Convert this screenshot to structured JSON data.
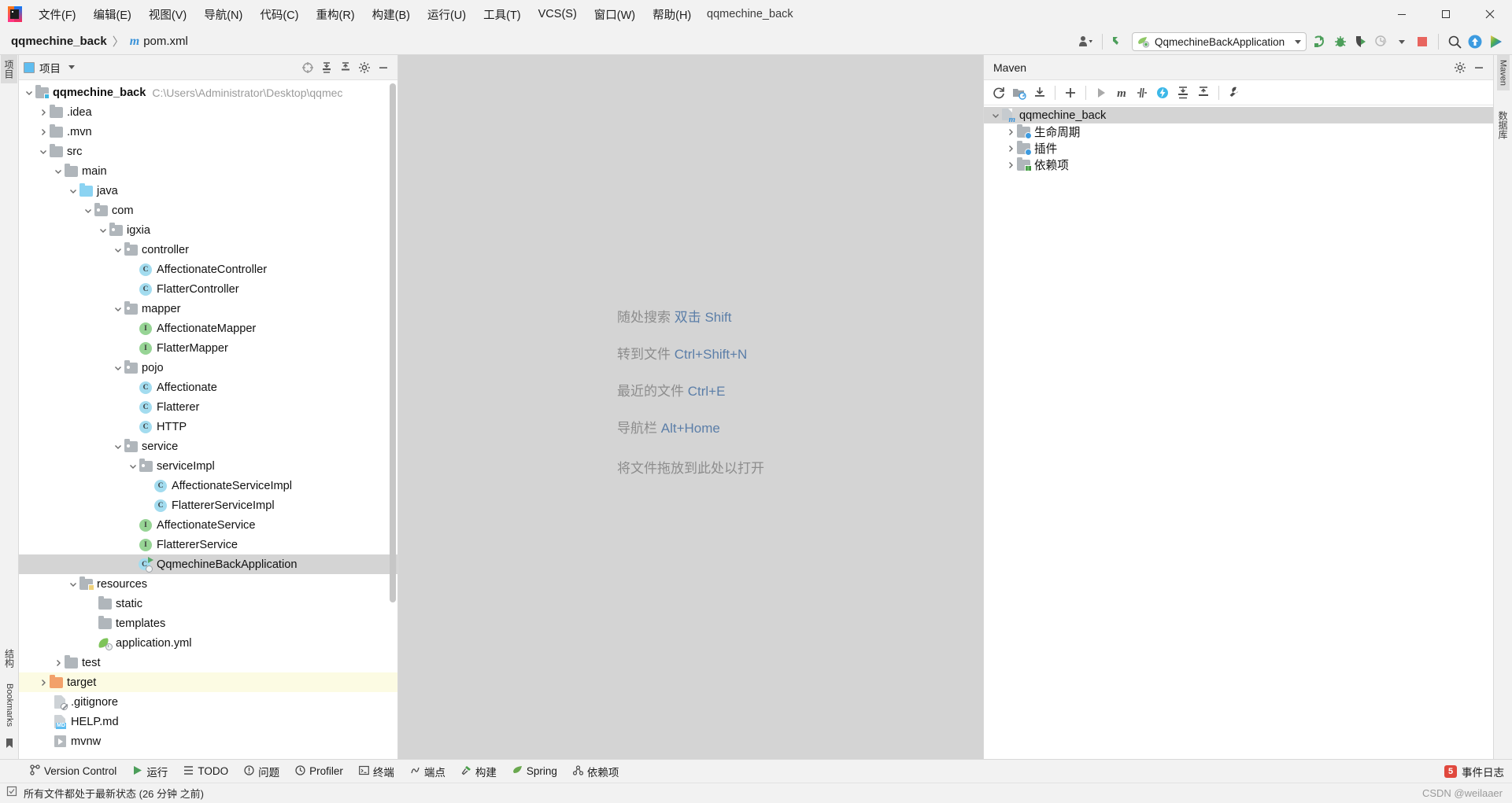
{
  "window": {
    "title": "qqmechine_back",
    "menus": [
      {
        "label": "文件(F)",
        "mnemonic": "F"
      },
      {
        "label": "编辑(E)",
        "mnemonic": "E"
      },
      {
        "label": "视图(V)",
        "mnemonic": "V"
      },
      {
        "label": "导航(N)",
        "mnemonic": "N"
      },
      {
        "label": "代码(C)",
        "mnemonic": "C"
      },
      {
        "label": "重构(R)",
        "mnemonic": "R"
      },
      {
        "label": "构建(B)",
        "mnemonic": "B"
      },
      {
        "label": "运行(U)",
        "mnemonic": "U"
      },
      {
        "label": "工具(T)",
        "mnemonic": "T"
      },
      {
        "label": "VCS(S)",
        "mnemonic": "S"
      },
      {
        "label": "窗口(W)",
        "mnemonic": "W"
      },
      {
        "label": "帮助(H)",
        "mnemonic": "H"
      }
    ],
    "controls": {
      "minimize": "minimize-icon",
      "maximize": "maximize-icon",
      "close": "close-icon"
    }
  },
  "breadcrumb": {
    "project": "qqmechine_back",
    "separator": "〉",
    "maven_glyph": "m",
    "file": "pom.xml"
  },
  "toolbar": {
    "account_icon": "user-account-icon",
    "updates_icon": "check-updates-arrow-icon",
    "run_config": {
      "icon": "spring-boot-run-config-icon",
      "label": "QqmechineBackApplication",
      "dropdown_icon": "chevron-down-icon"
    },
    "actions": [
      {
        "name": "run-button",
        "icon": "run-green-arrow-icon"
      },
      {
        "name": "debug-button",
        "icon": "debug-bug-icon"
      },
      {
        "name": "run-with-coverage-button",
        "icon": "coverage-shield-icon"
      },
      {
        "name": "profiler-button",
        "icon": "profiler-clock-icon"
      },
      {
        "name": "profiler-dropdown",
        "icon": "chevron-down-icon"
      },
      {
        "name": "stop-button",
        "icon": "stop-square-icon"
      },
      {
        "name": "search-everywhere-button",
        "icon": "search-icon"
      },
      {
        "name": "update-project-button",
        "icon": "blue-up-arrow-icon"
      },
      {
        "name": "ide-assistant-button",
        "icon": "rainbow-play-icon"
      }
    ]
  },
  "left_rail": {
    "tabs": [
      "项目"
    ],
    "bottom_tabs": [
      "结构",
      "Bookmarks"
    ]
  },
  "right_rail": {
    "tabs": [
      "Maven",
      "数据库"
    ]
  },
  "project_panel": {
    "title": "项目",
    "dropdown_icon": "chevron-down-icon",
    "header_icons": [
      {
        "name": "select-opened-file-icon",
        "icon": "crosshair-icon"
      },
      {
        "name": "expand-all-icon",
        "icon": "expand-all-icon"
      },
      {
        "name": "collapse-all-icon",
        "icon": "collapse-all-icon"
      },
      {
        "name": "settings-icon",
        "icon": "gear-icon"
      },
      {
        "name": "hide-panel-icon",
        "icon": "minus-icon"
      }
    ],
    "tree": [
      {
        "label": "qqmechine_back",
        "path": "C:\\Users\\Administrator\\Desktop\\qqmec",
        "depth": 0,
        "icon": "module-folder-icon",
        "arrow": "expanded",
        "bold": true
      },
      {
        "label": ".idea",
        "depth": 1,
        "icon": "folder-icon",
        "arrow": "collapsed"
      },
      {
        "label": ".mvn",
        "depth": 1,
        "icon": "folder-icon",
        "arrow": "collapsed"
      },
      {
        "label": "src",
        "depth": 1,
        "icon": "folder-icon",
        "arrow": "expanded"
      },
      {
        "label": "main",
        "depth": 2,
        "icon": "folder-icon",
        "arrow": "expanded"
      },
      {
        "label": "java",
        "depth": 3,
        "icon": "source-folder-icon",
        "arrow": "expanded"
      },
      {
        "label": "com",
        "depth": 4,
        "icon": "package-folder-icon",
        "arrow": "expanded"
      },
      {
        "label": "igxia",
        "depth": 5,
        "icon": "package-folder-icon",
        "arrow": "expanded"
      },
      {
        "label": "controller",
        "depth": 6,
        "icon": "package-folder-icon",
        "arrow": "expanded"
      },
      {
        "label": "AffectionateController",
        "depth": 7,
        "icon": "java-class-icon"
      },
      {
        "label": "FlatterController",
        "depth": 7,
        "icon": "java-class-icon"
      },
      {
        "label": "mapper",
        "depth": 6,
        "icon": "package-folder-icon",
        "arrow": "expanded"
      },
      {
        "label": "AffectionateMapper",
        "depth": 7,
        "icon": "java-interface-icon"
      },
      {
        "label": "FlatterMapper",
        "depth": 7,
        "icon": "java-interface-icon"
      },
      {
        "label": "pojo",
        "depth": 6,
        "icon": "package-folder-icon",
        "arrow": "expanded"
      },
      {
        "label": "Affectionate",
        "depth": 7,
        "icon": "java-class-icon"
      },
      {
        "label": "Flatterer",
        "depth": 7,
        "icon": "java-class-icon"
      },
      {
        "label": "HTTP",
        "depth": 7,
        "icon": "java-class-icon"
      },
      {
        "label": "service",
        "depth": 6,
        "icon": "package-folder-icon",
        "arrow": "expanded"
      },
      {
        "label": "serviceImpl",
        "depth": 7,
        "icon": "package-folder-icon",
        "arrow": "expanded"
      },
      {
        "label": "AffectionateServiceImpl",
        "depth": 8,
        "icon": "java-class-icon"
      },
      {
        "label": "FlattererServiceImpl",
        "depth": 8,
        "icon": "java-class-icon"
      },
      {
        "label": "AffectionateService",
        "depth": 7,
        "icon": "java-interface-icon"
      },
      {
        "label": "FlattererService",
        "depth": 7,
        "icon": "java-interface-icon"
      },
      {
        "label": "QqmechineBackApplication",
        "depth": 7,
        "icon": "spring-boot-app-class-icon",
        "selected": true
      },
      {
        "label": "resources",
        "depth": 3,
        "icon": "resources-folder-icon",
        "arrow": "expanded"
      },
      {
        "label": "static",
        "depth": 4,
        "icon": "folder-icon"
      },
      {
        "label": "templates",
        "depth": 4,
        "icon": "folder-icon"
      },
      {
        "label": "application.yml",
        "depth": 4,
        "icon": "spring-yaml-icon"
      },
      {
        "label": "test",
        "depth": 2,
        "icon": "folder-icon",
        "arrow": "collapsed"
      },
      {
        "label": "target",
        "depth": 1,
        "icon": "excluded-folder-icon",
        "arrow": "collapsed",
        "highlight": true
      },
      {
        "label": ".gitignore",
        "depth": 1,
        "icon": "gitignore-file-icon"
      },
      {
        "label": "HELP.md",
        "depth": 1,
        "icon": "markdown-file-icon"
      },
      {
        "label": "mvnw",
        "depth": 1,
        "icon": "shell-script-icon"
      }
    ]
  },
  "editor": {
    "hints": [
      {
        "text": "随处搜索",
        "key": "双击 Shift"
      },
      {
        "text": "转到文件",
        "key": "Ctrl+Shift+N"
      },
      {
        "text": "最近的文件",
        "key": "Ctrl+E"
      },
      {
        "text": "导航栏",
        "key": "Alt+Home"
      }
    ],
    "drop_hint": "将文件拖放到此处以打开"
  },
  "maven_panel": {
    "title": "Maven",
    "header_icons": [
      {
        "name": "settings-icon",
        "icon": "gear-icon"
      },
      {
        "name": "hide-panel-icon",
        "icon": "minus-icon"
      }
    ],
    "toolbar_icons": [
      {
        "name": "reload-all-maven-projects",
        "icon": "refresh-icon"
      },
      {
        "name": "add-maven-project",
        "icon": "add-folder-icon"
      },
      {
        "name": "download-sources",
        "icon": "download-icon"
      },
      {
        "name": "add-plugin",
        "icon": "plus-icon"
      },
      {
        "name": "run-maven-build",
        "icon": "play-icon"
      },
      {
        "name": "execute-maven-goal",
        "icon": "maven-m-icon"
      },
      {
        "name": "toggle-skip-tests",
        "icon": "skip-tests-icon"
      },
      {
        "name": "toggle-offline-mode",
        "icon": "offline-bolt-icon"
      },
      {
        "name": "expand-all-icon",
        "icon": "expand-all-icon"
      },
      {
        "name": "collapse-all-icon",
        "icon": "collapse-all-icon"
      },
      {
        "name": "maven-settings",
        "icon": "wrench-icon"
      }
    ],
    "tree": [
      {
        "label": "qqmechine_back",
        "depth": 0,
        "icon": "maven-project-icon",
        "arrow": "expanded",
        "selected": true
      },
      {
        "label": "生命周期",
        "depth": 1,
        "icon": "lifecycle-folder-icon",
        "arrow": "collapsed"
      },
      {
        "label": "插件",
        "depth": 1,
        "icon": "plugins-folder-icon",
        "arrow": "collapsed"
      },
      {
        "label": "依赖项",
        "depth": 1,
        "icon": "dependencies-folder-icon",
        "arrow": "collapsed"
      }
    ]
  },
  "tool_strip": {
    "items": [
      {
        "label": "Version Control",
        "icon": "branch-icon"
      },
      {
        "label": "运行",
        "icon": "run-green-arrow-icon"
      },
      {
        "label": "TODO",
        "icon": "todo-list-icon"
      },
      {
        "label": "问题",
        "icon": "problems-icon"
      },
      {
        "label": "Profiler",
        "icon": "profiler-icon"
      },
      {
        "label": "终端",
        "icon": "terminal-icon"
      },
      {
        "label": "端点",
        "icon": "endpoints-icon"
      },
      {
        "label": "构建",
        "icon": "build-hammer-icon"
      },
      {
        "label": "Spring",
        "icon": "spring-leaf-icon"
      },
      {
        "label": "依赖项",
        "icon": "dependencies-icon"
      }
    ],
    "right": {
      "label": "事件日志",
      "badge": "5"
    }
  },
  "statusbar": {
    "icon": "file-status-icon",
    "text": "所有文件都处于最新状态 (26 分钟 之前)",
    "watermark": "CSDN @weilaaer"
  }
}
